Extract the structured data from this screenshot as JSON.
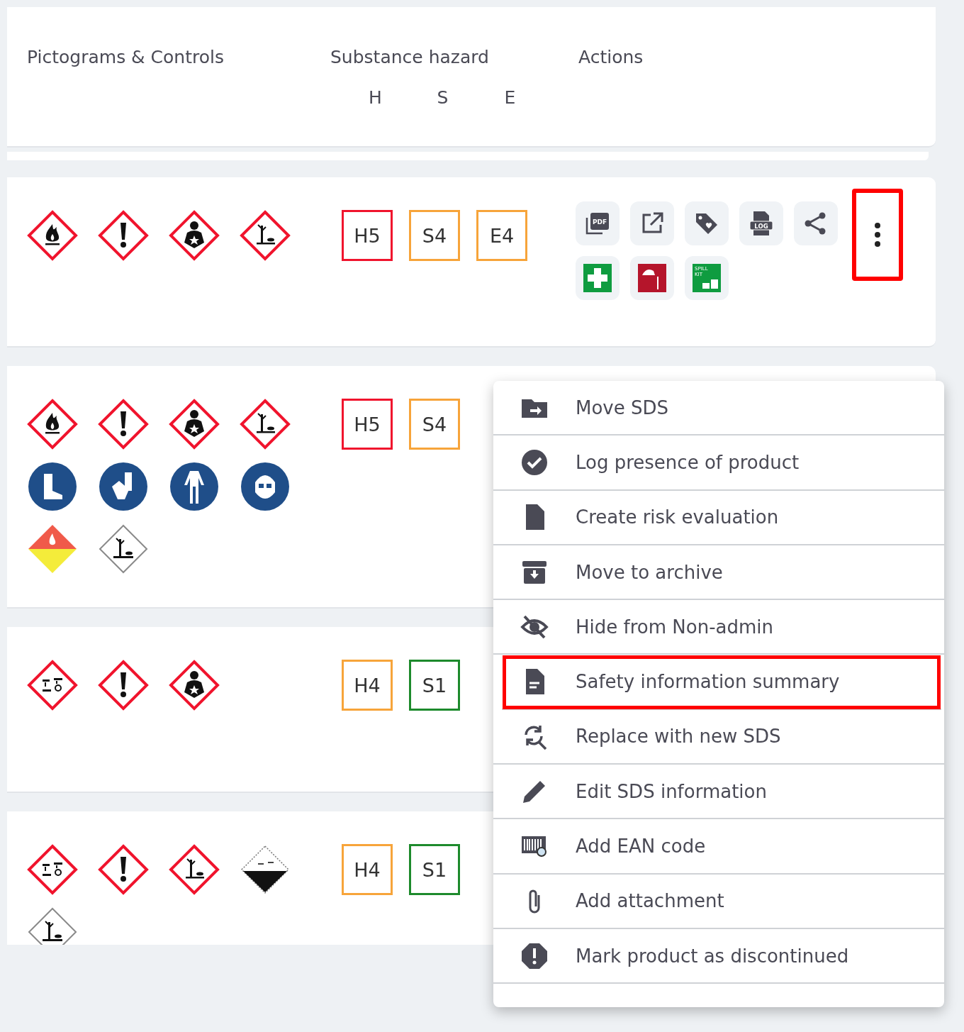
{
  "header": {
    "columns": [
      {
        "label": "Pictograms & Controls"
      },
      {
        "label": "Substance hazard",
        "sub_labels": [
          "H",
          "S",
          "E"
        ]
      },
      {
        "label": "Actions"
      }
    ]
  },
  "rows": [
    {
      "pictograms": [
        {
          "kind": "flame"
        },
        {
          "kind": "exclamation"
        },
        {
          "kind": "health"
        },
        {
          "kind": "environment"
        }
      ],
      "hazards": [
        {
          "text": "H5",
          "color": "#f0142d"
        },
        {
          "text": "S4",
          "color": "#f7a43a"
        },
        {
          "text": "E4",
          "color": "#f7a43a"
        }
      ],
      "actions": [
        {
          "kind": "pdf",
          "text": "PDF"
        },
        {
          "kind": "external"
        },
        {
          "kind": "tag"
        },
        {
          "kind": "log",
          "text": "LOG"
        },
        {
          "kind": "share"
        },
        {
          "kind": "first-aid"
        },
        {
          "kind": "fire-blanket"
        },
        {
          "kind": "spill-kit",
          "lines": [
            "SPILL",
            "KIT"
          ]
        }
      ],
      "menu_button": {
        "highlighted": true
      }
    },
    {
      "pictograms": [
        {
          "kind": "flame"
        },
        {
          "kind": "exclamation"
        },
        {
          "kind": "health"
        },
        {
          "kind": "environment"
        },
        {
          "kind": "boots"
        },
        {
          "kind": "gloves"
        },
        {
          "kind": "coverall"
        },
        {
          "kind": "respirator"
        },
        {
          "kind": "flammable-placard"
        },
        {
          "kind": "environment-placard"
        }
      ],
      "hazards": [
        {
          "text": "H5",
          "color": "#f0142d"
        },
        {
          "text": "S4",
          "color": "#f7a43a"
        }
      ]
    },
    {
      "pictograms": [
        {
          "kind": "corrosion"
        },
        {
          "kind": "exclamation"
        },
        {
          "kind": "health"
        }
      ],
      "hazards": [
        {
          "text": "H4",
          "color": "#f7a43a"
        },
        {
          "text": "S1",
          "color": "#1d8a2c"
        }
      ]
    },
    {
      "pictograms": [
        {
          "kind": "corrosion"
        },
        {
          "kind": "exclamation"
        },
        {
          "kind": "environment"
        },
        {
          "kind": "corrosive-placard"
        },
        {
          "kind": "environment-placard"
        }
      ],
      "hazards": [
        {
          "text": "H4",
          "color": "#f7a43a"
        },
        {
          "text": "S1",
          "color": "#1d8a2c"
        }
      ]
    }
  ],
  "menu": {
    "items": [
      {
        "kind": "move",
        "label": "Move SDS",
        "highlighted": false
      },
      {
        "kind": "check",
        "label": "Log presence of product",
        "highlighted": false
      },
      {
        "kind": "file",
        "label": "Create risk evaluation",
        "highlighted": false
      },
      {
        "kind": "archive",
        "label": "Move to archive",
        "highlighted": false
      },
      {
        "kind": "hide",
        "label": "Hide from Non-admin",
        "highlighted": false
      },
      {
        "kind": "summary",
        "label": "Safety information summary",
        "highlighted": true
      },
      {
        "kind": "replace",
        "label": "Replace with new SDS",
        "highlighted": false
      },
      {
        "kind": "edit",
        "label": "Edit SDS information",
        "highlighted": false
      },
      {
        "kind": "barcode",
        "label": "Add EAN code",
        "highlighted": false
      },
      {
        "kind": "attach",
        "label": "Add attachment",
        "highlighted": false
      },
      {
        "kind": "alert",
        "label": "Mark product as discontinued",
        "highlighted": false
      }
    ]
  }
}
